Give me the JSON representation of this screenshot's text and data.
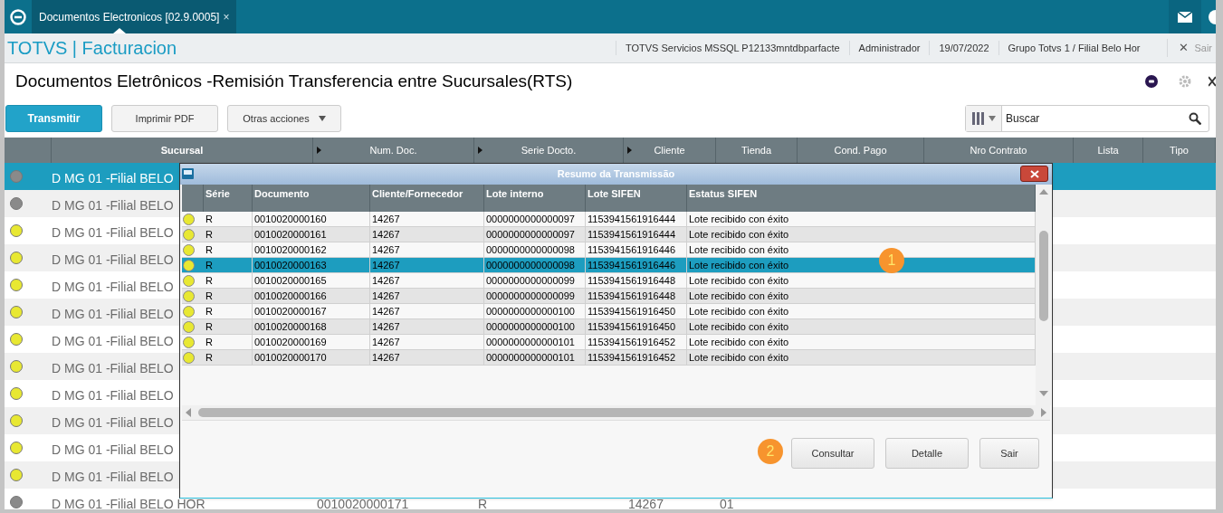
{
  "app_bar": {
    "tab": {
      "label": "Documentos Electronicos [02.9.0005]",
      "close": "×",
      "selected": true
    }
  },
  "header": {
    "app_title": "TOTVS | Facturacion",
    "info": [
      "TOTVS Servicios MSSQL P12133mntdbparfacte",
      "Administrador",
      "19/07/2022",
      "Grupo Totvs 1 / Filial Belo Hor"
    ],
    "exit": {
      "icon": "✕",
      "label": "Sair"
    }
  },
  "page": {
    "title": "Documentos Eletrônicos -Remisión Transferencia entre Sucursales(RTS)"
  },
  "toolbar": {
    "buttons": [
      {
        "label": "Transmitir",
        "kind": "primary"
      },
      {
        "label": "Imprimir PDF",
        "kind": "default"
      },
      {
        "label": "Otras acciones",
        "kind": "menu"
      }
    ],
    "search": {
      "placeholder": "Buscar"
    }
  },
  "table": {
    "columns": [
      {
        "label": "Sucursal",
        "sort_arrow": false
      },
      {
        "label": "Num. Doc.",
        "sort_arrow": true
      },
      {
        "label": "Serie Docto.",
        "sort_arrow": true
      },
      {
        "label": "Cliente",
        "sort_arrow": true
      },
      {
        "label": "Tienda",
        "sort_arrow": false
      },
      {
        "label": "Cond. Pago",
        "sort_arrow": false
      },
      {
        "label": "Nro Contrato",
        "sort_arrow": false
      },
      {
        "label": "Lista",
        "sort_arrow": false
      },
      {
        "label": "Tipo",
        "sort_arrow": false
      }
    ],
    "rows": [
      {
        "color": "#8a8a8a",
        "selected": true,
        "cells": [
          "D MG 01 -Filial BELO"
        ]
      },
      {
        "color": "#8a8a8a",
        "selected": false,
        "cells": [
          "D MG 01 -Filial BELO"
        ]
      },
      {
        "color": "#e8e832",
        "selected": false,
        "cells": [
          "D MG 01 -Filial BELO"
        ]
      },
      {
        "color": "#e8e832",
        "selected": false,
        "cells": [
          "D MG 01 -Filial BELO"
        ]
      },
      {
        "color": "#e8e832",
        "selected": false,
        "cells": [
          "D MG 01 -Filial BELO"
        ]
      },
      {
        "color": "#e8e832",
        "selected": false,
        "cells": [
          "D MG 01 -Filial BELO"
        ]
      },
      {
        "color": "#e8e832",
        "selected": false,
        "cells": [
          "D MG 01 -Filial BELO"
        ]
      },
      {
        "color": "#e8e832",
        "selected": false,
        "cells": [
          "D MG 01 -Filial BELO"
        ]
      },
      {
        "color": "#e8e832",
        "selected": false,
        "cells": [
          "D MG 01 -Filial BELO"
        ]
      },
      {
        "color": "#e8e832",
        "selected": false,
        "cells": [
          "D MG 01 -Filial BELO"
        ]
      },
      {
        "color": "#e8e832",
        "selected": false,
        "cells": [
          "D MG 01 -Filial BELO"
        ]
      },
      {
        "color": "#e8e832",
        "selected": false,
        "cells": [
          "D MG 01 -Filial BELO"
        ]
      },
      {
        "color": "#8a8a8a",
        "selected": false,
        "cells": [
          "D MG 01 -Filial BELO HOR",
          "0010020000171",
          "R",
          "14267",
          "01"
        ]
      }
    ]
  },
  "dialog": {
    "title": "Resumo da Transmissão",
    "columns": [
      "Série",
      "Documento",
      "Cliente/Fornecedor",
      "Lote interno",
      "Lote SIFEN",
      "Estatus SIFEN"
    ],
    "rows": [
      {
        "color": "#e8e832",
        "selected": false,
        "cells": [
          "R",
          "0010020000160",
          "14267",
          "0000000000000097",
          "1153941561916444",
          "Lote recibido con éxito"
        ]
      },
      {
        "color": "#e8e832",
        "selected": false,
        "cells": [
          "R",
          "0010020000161",
          "14267",
          "0000000000000097",
          "1153941561916444",
          "Lote recibido con éxito"
        ]
      },
      {
        "color": "#e8e832",
        "selected": false,
        "cells": [
          "R",
          "0010020000162",
          "14267",
          "0000000000000098",
          "1153941561916446",
          "Lote recibido con éxito"
        ]
      },
      {
        "color": "#e8e832",
        "selected": true,
        "cells": [
          "R",
          "0010020000163",
          "14267",
          "0000000000000098",
          "1153941561916446",
          "Lote recibido con éxito"
        ]
      },
      {
        "color": "#e8e832",
        "selected": false,
        "cells": [
          "R",
          "0010020000165",
          "14267",
          "0000000000000099",
          "1153941561916448",
          "Lote recibido con éxito"
        ]
      },
      {
        "color": "#e8e832",
        "selected": false,
        "cells": [
          "R",
          "0010020000166",
          "14267",
          "0000000000000099",
          "1153941561916448",
          "Lote recibido con éxito"
        ]
      },
      {
        "color": "#e8e832",
        "selected": false,
        "cells": [
          "R",
          "0010020000167",
          "14267",
          "0000000000000100",
          "1153941561916450",
          "Lote recibido con éxito"
        ]
      },
      {
        "color": "#e8e832",
        "selected": false,
        "cells": [
          "R",
          "0010020000168",
          "14267",
          "0000000000000100",
          "1153941561916450",
          "Lote recibido con éxito"
        ]
      },
      {
        "color": "#e8e832",
        "selected": false,
        "cells": [
          "R",
          "0010020000169",
          "14267",
          "0000000000000101",
          "1153941561916452",
          "Lote recibido con éxito"
        ]
      },
      {
        "color": "#e8e832",
        "selected": false,
        "cells": [
          "R",
          "0010020000170",
          "14267",
          "0000000000000101",
          "1153941561916452",
          "Lote recibido con éxito"
        ]
      }
    ],
    "buttons": [
      "Consultar",
      "Detalle",
      "Sair"
    ]
  },
  "annotations": [
    {
      "label": "1"
    },
    {
      "label": "2"
    }
  ]
}
